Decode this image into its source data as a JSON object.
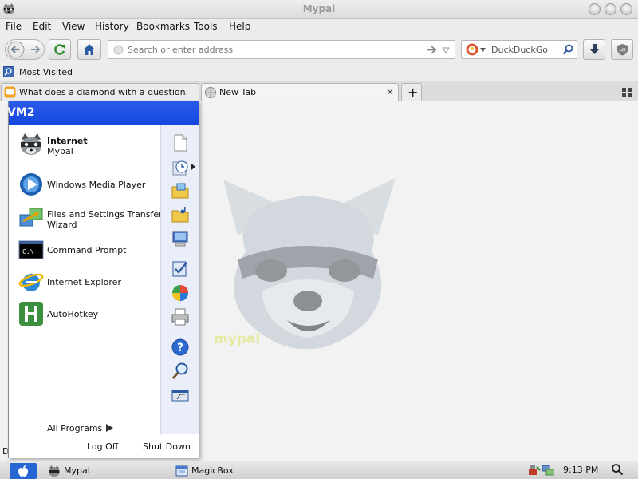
{
  "window": {
    "title": "Mypal"
  },
  "menubar": [
    "File",
    "Edit",
    "View",
    "History",
    "Bookmarks",
    "Tools",
    "Help"
  ],
  "navbar": {
    "url_placeholder": "Search or enter address",
    "search_engine": "DuckDuckGo"
  },
  "bookmarks": {
    "most_visited": "Most Visited"
  },
  "tabs": [
    {
      "label": "What does a diamond with a question...",
      "close": "×"
    },
    {
      "label": "New Tab",
      "close": "×"
    }
  ],
  "new_tab_symbol": "+",
  "content": {
    "watermark": "mypal"
  },
  "start_menu": {
    "header": "VM2",
    "pinned": [
      {
        "title": "Internet",
        "subtitle": "Mypal"
      },
      {
        "title": "Windows Media Player"
      },
      {
        "title": "Files and Settings Transfer",
        "subtitle": "Wizard"
      },
      {
        "title": "Command Prompt"
      },
      {
        "title": "Internet Explorer"
      },
      {
        "title": "AutoHotkey"
      }
    ],
    "all_programs": "All Programs",
    "log_off": "Log Off",
    "shut_down": "Shut Down"
  },
  "taskbar": {
    "tasks": [
      {
        "label": "Mypal"
      },
      {
        "label": "MagicBox"
      }
    ],
    "clock": "9:13 PM"
  },
  "status_partial": "D"
}
